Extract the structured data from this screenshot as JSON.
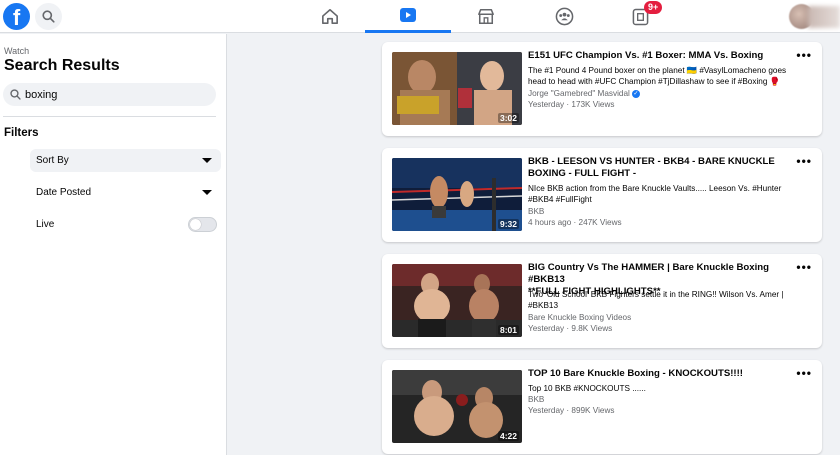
{
  "nav": {
    "logo_letter": "f",
    "tabs": [
      "Home",
      "Watch",
      "Marketplace",
      "Groups",
      "Gaming"
    ],
    "badge": "9+"
  },
  "sidebar": {
    "kicker": "Watch",
    "title": "Search Results",
    "search_value": "boxing",
    "filters_label": "Filters",
    "sort_by": "Sort By",
    "date_posted": "Date Posted",
    "live": "Live"
  },
  "videos": [
    {
      "title": "E151 UFC Champion Vs. #1 Boxer: MMA Vs. Boxing",
      "desc_line1": "The #1 Pound 4 Pound boxer on the planet 🇺🇦 #VasylLomacheno goes",
      "desc_line2": "head to head with #UFC Champion #TjDillashaw to see if #Boxing 🥊",
      "channel": "Jorge \"Gamebred\" Masvidal",
      "meta": "Yesterday · 173K Views",
      "duration": "3:02"
    },
    {
      "title_line1": "BKB - LEESON VS HUNTER - BKB4 - BARE KNUCKLE",
      "title_line2": "BOXING - FULL FIGHT -",
      "desc_line1": "NIce BKB action from the Bare Knuckle Vaults..... Leeson Vs. #Hunter",
      "desc_line2": "#BKB4 #FullFight",
      "channel": "BKB",
      "meta": "4 hours ago · 247K Views",
      "duration": "9:32"
    },
    {
      "title_line1": "BIG Country Vs The HAMMER | Bare Knuckle Boxing #BKB13",
      "title_line2": "**FULL FIGHT HIGHLIGHTS**",
      "desc_line1": "Two 'Old School' BKB Fighters settle it in the RING!! Wilson Vs. Amer |",
      "desc_line2": "#BKB13",
      "channel": "Bare Knuckle Boxing Videos",
      "meta": "Yesterday · 9.8K Views",
      "duration": "8:01"
    },
    {
      "title": "TOP 10 Bare Knuckle Boxing - KNOCKOUTS!!!!",
      "desc_line1": "Top 10 BKB #KNOCKOUTS ......",
      "channel": "BKB",
      "meta": "Yesterday · 899K Views",
      "duration": "4:22"
    }
  ],
  "more_label": "•••",
  "colors": {
    "brand": "#1877f2",
    "badge": "#e41e3f",
    "background": "#f0f2f5"
  }
}
